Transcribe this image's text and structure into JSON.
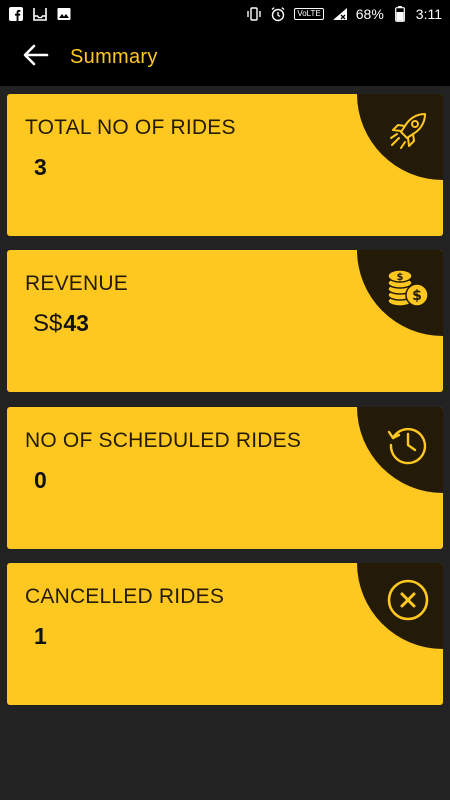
{
  "status_bar": {
    "battery": "68%",
    "time": "3:11",
    "network_badge": "VoLTE",
    "icons_left": [
      "facebook-icon",
      "inbox-icon",
      "image-icon"
    ],
    "icons_right": [
      "vibrate-icon",
      "alarm-icon",
      "volte-icon",
      "signal-icon",
      "battery-icon"
    ]
  },
  "app_bar": {
    "title": "Summary",
    "back_icon": "arrow-left-icon"
  },
  "cards": [
    {
      "label": "TOTAL NO OF RIDES",
      "value": "3",
      "prefix": "",
      "icon": "rocket-icon"
    },
    {
      "label": "REVENUE",
      "value": "43",
      "prefix": "S$",
      "icon": "coins-icon"
    },
    {
      "label": "NO OF SCHEDULED RIDES",
      "value": "0",
      "prefix": "",
      "icon": "history-icon"
    },
    {
      "label": "CANCELLED RIDES",
      "value": "1",
      "prefix": "",
      "icon": "cancel-icon"
    }
  ],
  "colors": {
    "accent": "#ffc820",
    "corner": "#231b08",
    "background": "#222222",
    "bar": "#000000"
  }
}
